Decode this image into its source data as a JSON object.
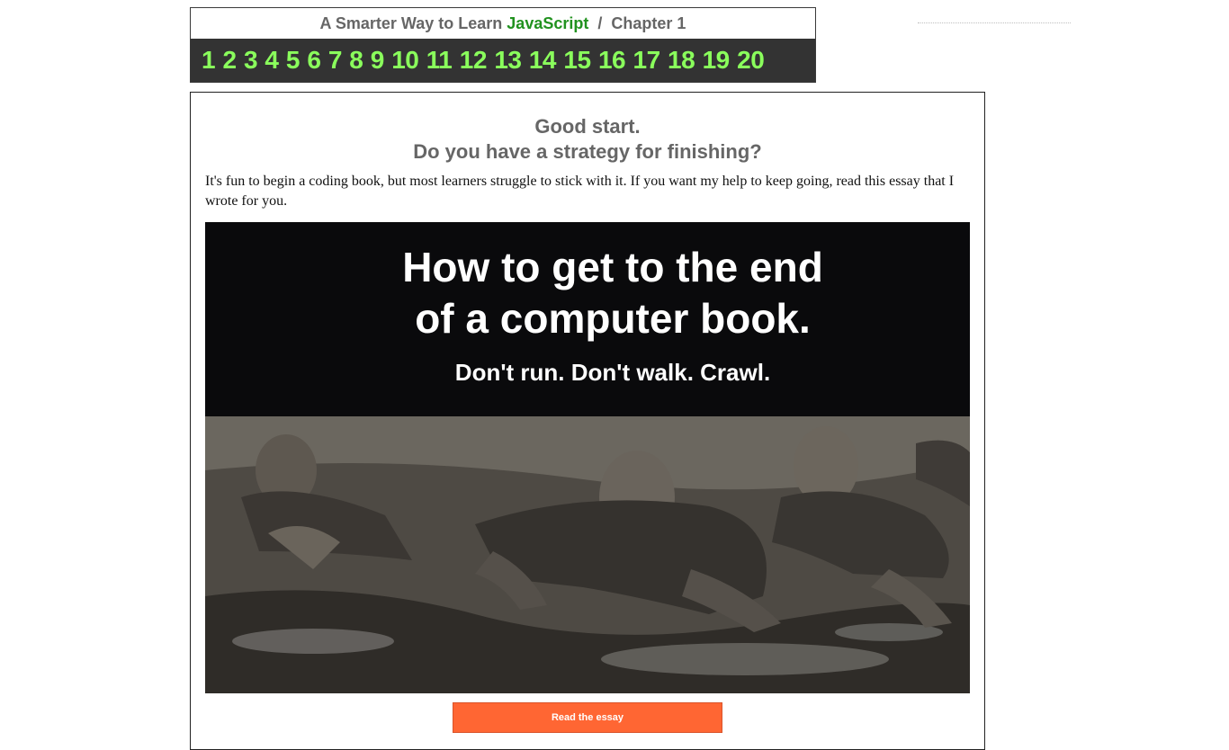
{
  "header": {
    "title_prefix": "A Smarter Way to Learn",
    "title_highlight": "JavaScript",
    "title_separator": "/",
    "title_suffix": "Chapter 1",
    "chapters": [
      "1",
      "2",
      "3",
      "4",
      "5",
      "6",
      "7",
      "8",
      "9",
      "10",
      "11",
      "12",
      "13",
      "14",
      "15",
      "16",
      "17",
      "18",
      "19",
      "20"
    ]
  },
  "main": {
    "headline_line1": "Good start.",
    "headline_line2": "Do you have a strategy for finishing?",
    "intro": "It's fun to begin a coding book, but most learners struggle to stick with it. If you want my help to keep going, read this essay that I wrote for you.",
    "hero": {
      "title_line1": "How to get to the end",
      "title_line2": "of a computer book.",
      "subtitle": "Don't run. Don't walk. Crawl."
    },
    "cta_label": "Read the essay"
  },
  "colors": {
    "accent_green": "#21921f",
    "chapter_link": "#8aff5c",
    "nav_bg": "#333333",
    "cta_bg": "#ff6633"
  }
}
